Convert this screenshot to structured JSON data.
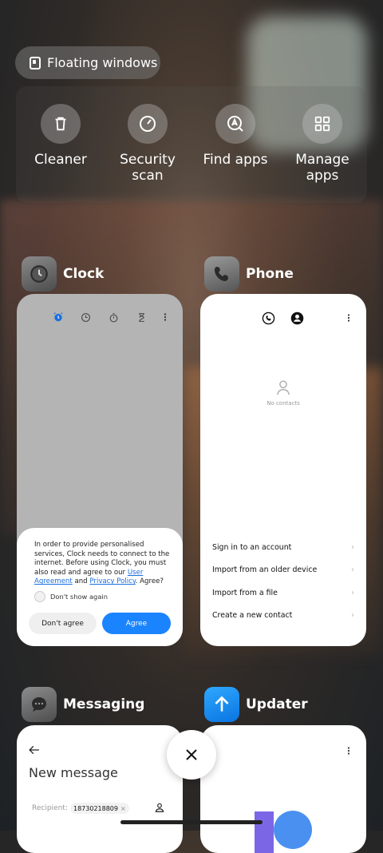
{
  "floating_windows": {
    "label": "Floating windows",
    "icon": "floating-window-icon"
  },
  "quick_actions": [
    {
      "label": "Cleaner",
      "icon": "trash-icon"
    },
    {
      "label": "Security\nscan",
      "icon": "security-scan-icon"
    },
    {
      "label": "Find apps",
      "icon": "find-apps-icon"
    },
    {
      "label": "Manage\napps",
      "icon": "grid-icon"
    }
  ],
  "apps": {
    "clock": {
      "name": "Clock",
      "dialog": {
        "text_before": "In order to provide personalised services, Clock needs to connect to the internet. Before using Clock, you must also read and agree to our ",
        "link1": "User Agreement",
        "and": " and ",
        "link2": "Privacy Policy",
        "text_after": ". Agree?",
        "checkbox": "Don't show again",
        "disagree": "Don't agree",
        "agree": "Agree"
      }
    },
    "phone": {
      "name": "Phone",
      "empty": "No contacts",
      "rows": [
        "Sign in to an account",
        "Import from an older device",
        "Import from a file",
        "Create a new contact"
      ]
    },
    "messaging": {
      "name": "Messaging",
      "title": "New message",
      "recipient_label": "Recipient:",
      "recipient_value": "18730218809"
    },
    "updater": {
      "name": "Updater"
    }
  },
  "colors": {
    "accent": "#1a84ff",
    "clock_alarm": "#1a6fe0"
  }
}
